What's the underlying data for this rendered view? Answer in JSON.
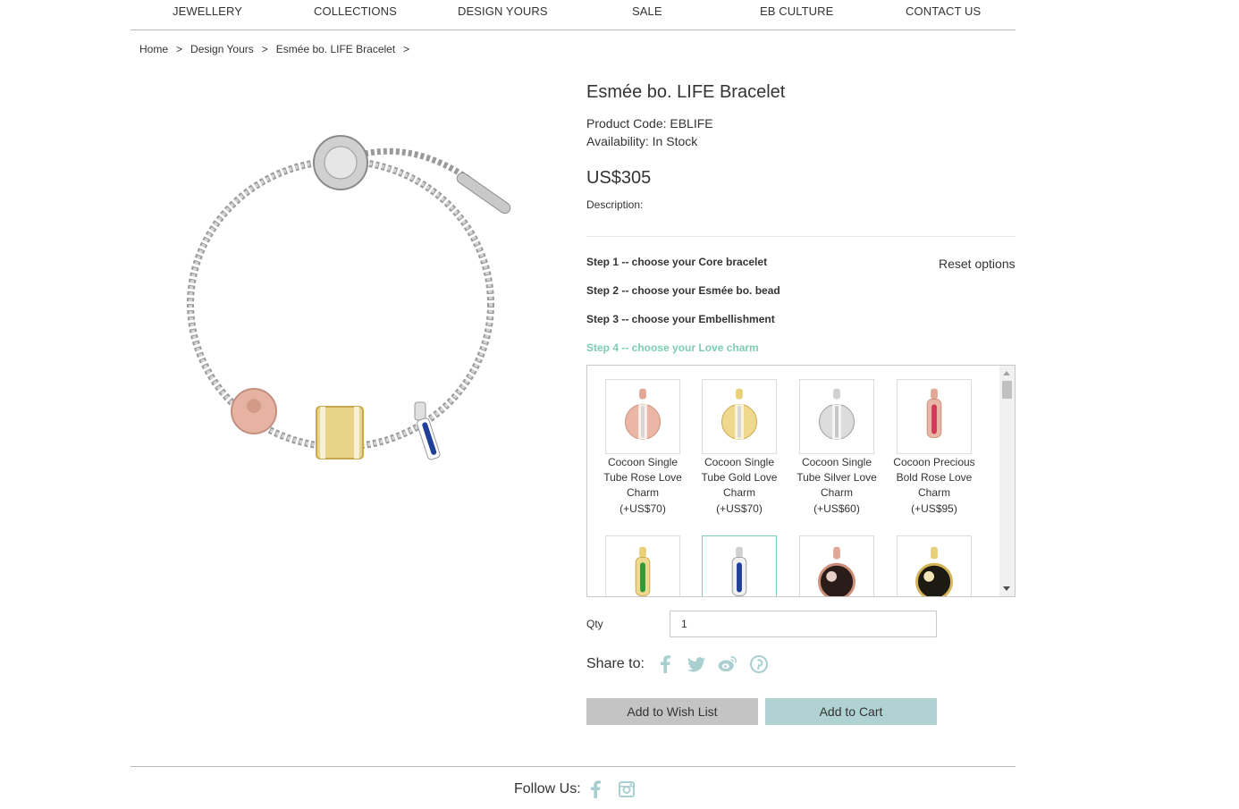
{
  "nav": {
    "items": [
      "JEWELLERY",
      "COLLECTIONS",
      "DESIGN YOURS",
      "SALE",
      "EB CULTURE",
      "CONTACT US"
    ]
  },
  "breadcrumb": {
    "items": [
      "Home",
      "Design Yours",
      "Esmée bo. LIFE Bracelet"
    ],
    "separator": ">"
  },
  "product": {
    "title": "Esmée bo. LIFE Bracelet",
    "code": "Product Code: EBLIFE",
    "availability": "Availability: In Stock",
    "price": "US$305",
    "description_label": "Description:"
  },
  "steps": {
    "step1_num": "Step 1",
    "step1_text": " -- choose your Core bracelet",
    "step2_num": "Step 2",
    "step2_text": " -- choose your Esmée bo. bead",
    "step3_num": "Step 3",
    "step3_text": " -- choose your Embellishment",
    "step4_num": "Step 4",
    "step4_text": " -- choose your Love charm",
    "reset_label": "Reset options"
  },
  "charms": [
    {
      "name": "Cocoon Single Tube Rose Love Charm",
      "price": "(+US$70)",
      "icon": "rose-tube-charm"
    },
    {
      "name": "Cocoon Single Tube Gold Love Charm",
      "price": "(+US$70)",
      "icon": "gold-tube-charm"
    },
    {
      "name": "Cocoon Single Tube Silver Love Charm",
      "price": "(+US$60)",
      "icon": "silver-tube-charm"
    },
    {
      "name": "Cocoon Precious Bold Rose Love Charm",
      "price": "(+US$95)",
      "icon": "ruby-bar-charm"
    },
    {
      "name": "",
      "price": "",
      "icon": "emerald-bar-charm"
    },
    {
      "name": "",
      "price": "",
      "icon": "sapphire-bar-charm"
    },
    {
      "name": "",
      "price": "",
      "icon": "rose-onyx-charm"
    },
    {
      "name": "",
      "price": "",
      "icon": "gold-onyx-charm"
    }
  ],
  "qty": {
    "label": "Qty",
    "value": "1"
  },
  "share": {
    "label": "Share to:",
    "icons": [
      "facebook-icon",
      "twitter-icon",
      "weibo-icon",
      "pinterest-icon"
    ]
  },
  "buttons": {
    "wishlist": "Add to Wish List",
    "cart": "Add to Cart"
  },
  "footer": {
    "follow_label": "Follow Us:",
    "icons": [
      "facebook-icon",
      "instagram-icon"
    ]
  },
  "colors": {
    "accent": "#7dcdb4",
    "cart_button": "#b0d2d2",
    "wishlist_button": "#c4c4c4",
    "social_icon": "#a9cfd0"
  }
}
